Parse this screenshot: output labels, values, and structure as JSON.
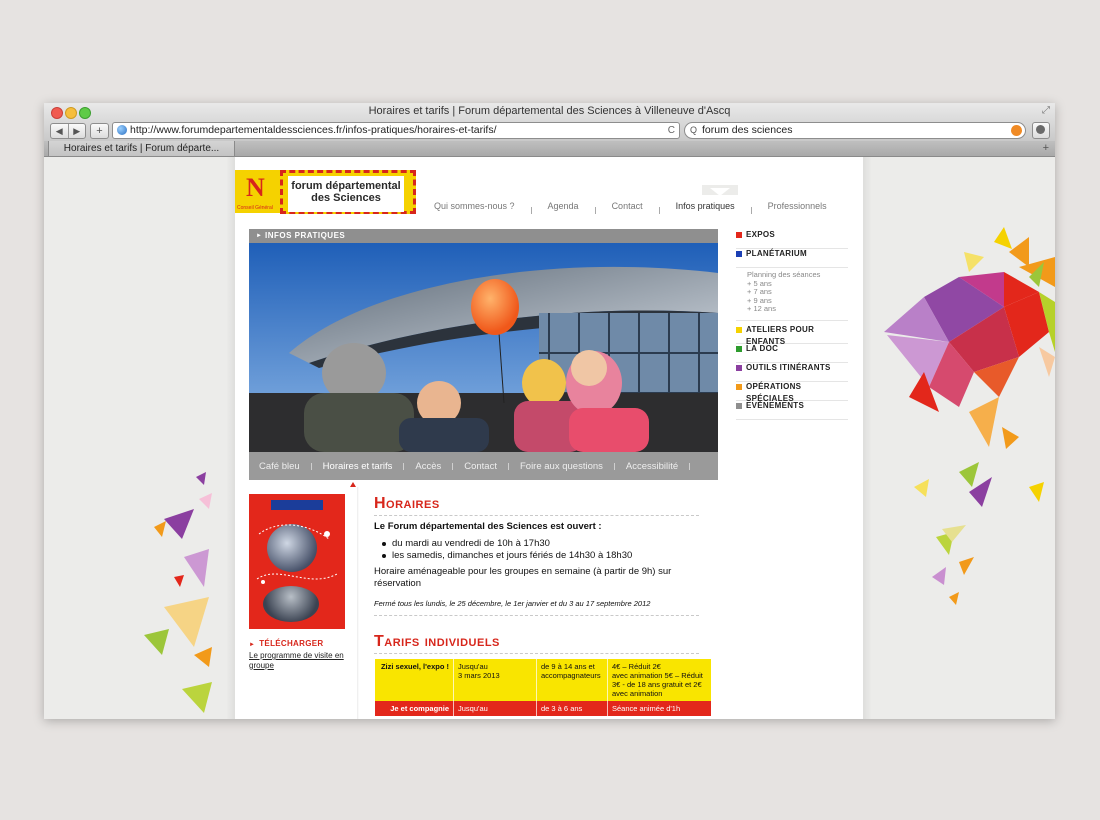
{
  "browser": {
    "window_title": "Horaires et tarifs | Forum départemental des Sciences à Villeneuve d'Ascq",
    "url": "http://www.forumdepartementaldessciences.fr/infos-pratiques/horaires-et-tarifs/",
    "search_value": "forum des sciences",
    "tab_title": "Horaires et tarifs | Forum départe...",
    "nav_back": "◀",
    "nav_forward": "▶",
    "add_label": "+",
    "reload_glyph": "C",
    "search_glyph": "Q",
    "tab_add": "+",
    "resize_glyph": "⤢"
  },
  "logo": {
    "letter": "N",
    "dept": "Conseil Général",
    "line1": "forum départemental",
    "line2": "des Sciences"
  },
  "topnav": {
    "items": [
      "Qui sommes-nous ?",
      "Agenda",
      "Contact",
      "Infos pratiques",
      "Professionnels"
    ],
    "active": "Infos pratiques"
  },
  "banner": {
    "arrow": "►",
    "heading": "Infos pratiques"
  },
  "subnav": {
    "items": [
      "Café bleu",
      "Horaires et tarifs",
      "Accès",
      "Contact",
      "Foire aux questions",
      "Accessibilité"
    ],
    "active": "Horaires et tarifs"
  },
  "sidebar": {
    "categories": [
      {
        "label": "Expos",
        "color": "#e3271b"
      },
      {
        "label": "Planétarium",
        "color": "#1b3fb4"
      },
      {
        "label": "Ateliers pour enfants",
        "color": "#f5d200"
      },
      {
        "label": "La doc",
        "color": "#2e9c2e"
      },
      {
        "label": "Outils itinérants",
        "color": "#8b3fa0"
      },
      {
        "label": "Opérations spéciales",
        "color": "#f29a1a"
      },
      {
        "label": "Evènements",
        "color": "#8f8f8f"
      }
    ],
    "planetarium_sub": [
      "Planning des séances",
      "+ 5 ans",
      "+ 7 ans",
      "+ 9 ans",
      "+ 12 ans"
    ]
  },
  "download": {
    "arrow": "►",
    "label": "Télécharger",
    "link": "Le programme de visite en groupe"
  },
  "horaires": {
    "title": "Horaires",
    "lead": "Le Forum départemental des Sciences est ouvert :",
    "bullets": [
      "du mardi au vendredi de 10h à 17h30",
      "les samedis, dimanches et jours fériés de 14h30 à 18h30"
    ],
    "note": "Horaire aménageable pour les groupes en semaine (à partir de 9h) sur réservation",
    "closed": "Fermé tous les lundis, le 25 décembre, le 1er janvier et du 3 au 17 septembre 2012"
  },
  "tarifs": {
    "title": "Tarifs individuels",
    "rows": [
      {
        "name": "Zizi sexuel, l'expo !",
        "date": "Jusqu'au\n3 mars 2013",
        "age": "de 9 à 14 ans et accompagnateurs",
        "price": "4€ – Réduit 2€\navec animation 5€ – Réduit 3€ - de 18 ans gratuit et 2€ avec animation",
        "style": "yellow"
      },
      {
        "name": "Je et compagnie",
        "date": "Jusqu'au",
        "age": "de 3 à 6 ans",
        "price": "Séance animée d'1h",
        "style": "red"
      }
    ]
  },
  "colors": {
    "accent_red": "#d7261b",
    "brand_yellow": "#f5d200",
    "nav_gray": "#9a9a9a"
  }
}
